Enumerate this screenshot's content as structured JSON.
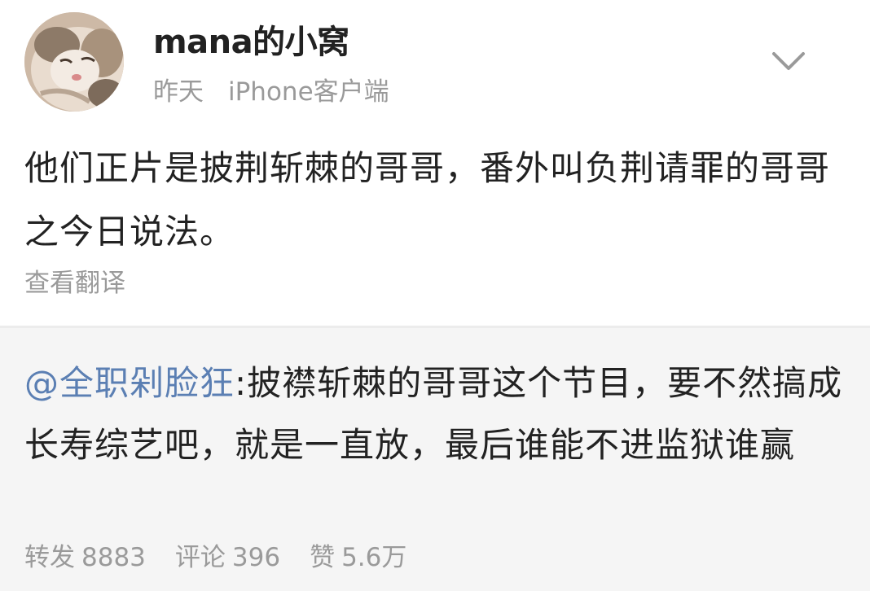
{
  "post": {
    "username": "mana的小窝",
    "time": "昨天",
    "source": "iPhone客户端",
    "text": "他们正片是披荆斩棘的哥哥，番外叫负荆请罪的哥哥之今日说法。",
    "translate_label": "查看翻译"
  },
  "repost": {
    "mention": "@全职剁脸狂",
    "text": ":披襟斩棘的哥哥这个节目，要不然搞成长寿综艺吧，就是一直放，最后谁能不进监狱谁赢",
    "stats": {
      "forward_label": "转发",
      "forward_count": "8883",
      "comment_label": "评论",
      "comment_count": "396",
      "like_label": "赞",
      "like_count": "5.6万"
    }
  },
  "icons": {
    "avatar": "cat-avatar",
    "menu": "chevron-down-icon"
  },
  "colors": {
    "mention": "#5b7fb3",
    "secondary_text": "#9a9a9a",
    "primary_text": "#222222",
    "repost_background": "#f5f5f5"
  }
}
